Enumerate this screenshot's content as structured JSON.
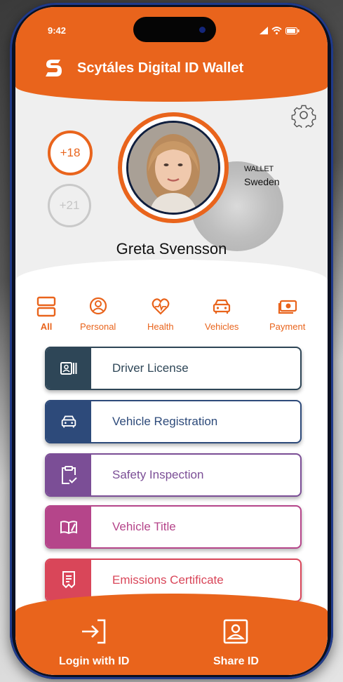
{
  "status": {
    "time": "9:42"
  },
  "app": {
    "title": "Scytáles Digital ID Wallet"
  },
  "badges": {
    "age18": "+18",
    "age21": "+21"
  },
  "wallet": {
    "label": "WALLET",
    "country": "Sweden"
  },
  "user": {
    "name": "Greta Svensson"
  },
  "categories": [
    {
      "label": "All",
      "icon": "stack-icon"
    },
    {
      "label": "Personal",
      "icon": "user-circle-icon"
    },
    {
      "label": "Health",
      "icon": "heart-pulse-icon"
    },
    {
      "label": "Vehicles",
      "icon": "car-icon"
    },
    {
      "label": "Payment",
      "icon": "money-icon"
    }
  ],
  "documents": [
    {
      "label": "Driver License",
      "icon": "id-card-icon",
      "color": "#2e4657"
    },
    {
      "label": "Vehicle Registration",
      "icon": "car-icon",
      "color": "#2d4a7a"
    },
    {
      "label": "Safety Inspection",
      "icon": "clipboard-check-icon",
      "color": "#7b4e96"
    },
    {
      "label": "Vehicle Title",
      "icon": "open-book-icon",
      "color": "#b5458a"
    },
    {
      "label": "Emissions Certificate",
      "icon": "receipt-icon",
      "color": "#d94659"
    }
  ],
  "footer": {
    "login": "Login with ID",
    "share": "Share ID"
  },
  "colors": {
    "accent": "#e9641c"
  }
}
